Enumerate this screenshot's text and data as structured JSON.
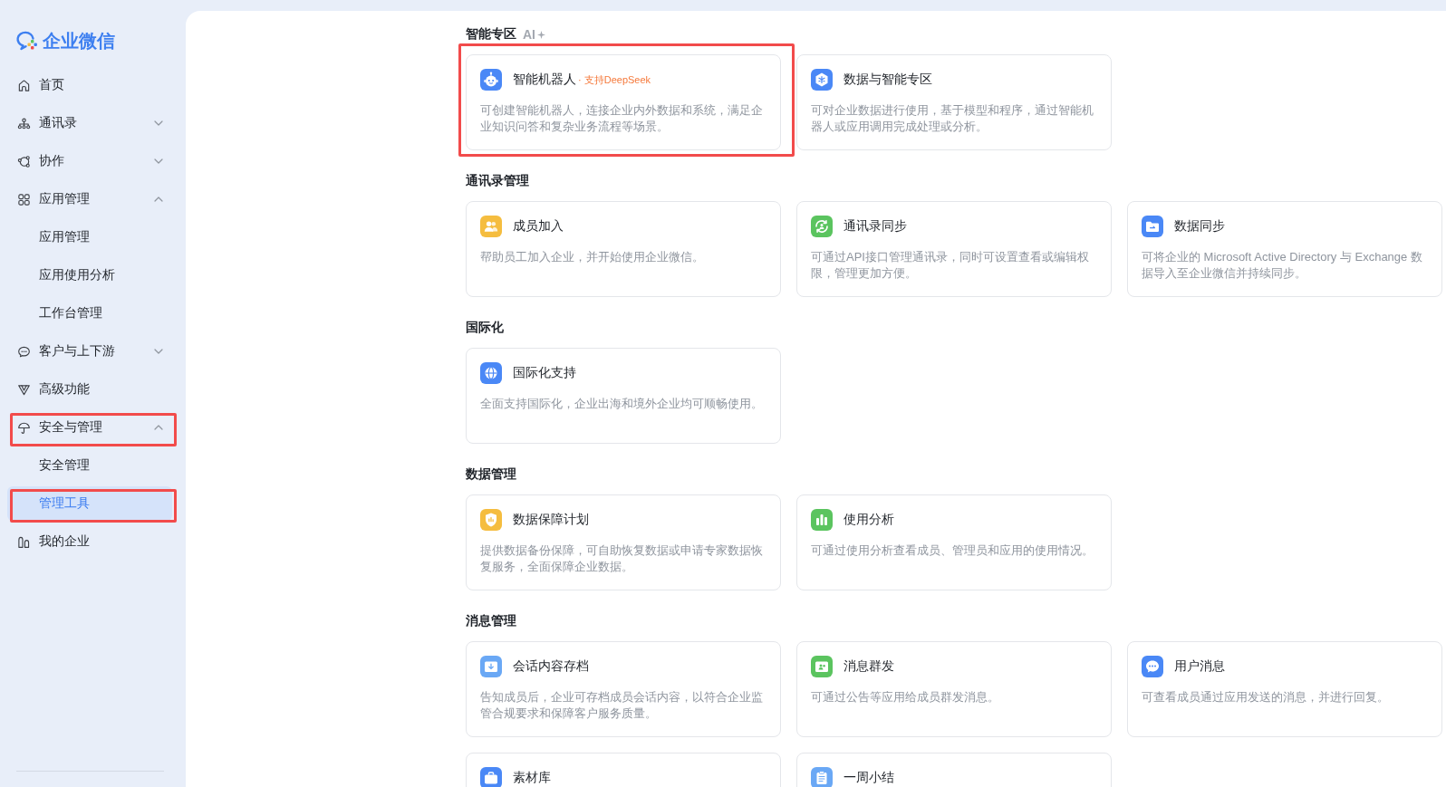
{
  "logo": {
    "text": "企业微信"
  },
  "sidebar": {
    "items": [
      {
        "kind": "page",
        "label": "首页",
        "selected": false,
        "highlighted": false
      },
      {
        "kind": "group",
        "label": "通讯录",
        "expanded": false,
        "selected": false,
        "highlighted": false
      },
      {
        "kind": "group",
        "label": "协作",
        "expanded": false,
        "selected": false,
        "highlighted": false
      },
      {
        "kind": "group",
        "label": "应用管理",
        "expanded": true,
        "selected": false,
        "highlighted": false,
        "children": [
          {
            "label": "应用管理",
            "selected": false,
            "highlighted": false
          },
          {
            "label": "应用使用分析",
            "selected": false,
            "highlighted": false
          },
          {
            "label": "工作台管理",
            "selected": false,
            "highlighted": false
          }
        ]
      },
      {
        "kind": "group",
        "label": "客户与上下游",
        "expanded": false,
        "selected": false,
        "highlighted": false
      },
      {
        "kind": "page",
        "label": "高级功能",
        "selected": false,
        "highlighted": false
      },
      {
        "kind": "group",
        "label": "安全与管理",
        "expanded": true,
        "selected": false,
        "highlighted": true,
        "children": [
          {
            "label": "安全管理",
            "selected": false,
            "highlighted": false
          },
          {
            "label": "管理工具",
            "selected": true,
            "highlighted": true
          }
        ]
      },
      {
        "kind": "page",
        "label": "我的企业",
        "selected": false,
        "highlighted": false
      }
    ]
  },
  "sections": [
    {
      "title": "智能专区",
      "tag": "AI",
      "cards": [
        {
          "title": "智能机器人",
          "note": "· 支持DeepSeek",
          "description": "可创建智能机器人，连接企业内外数据和系统，满足企业知识问答和复杂业务流程等场景。",
          "color": "#4a88f6",
          "highlighted": true
        },
        {
          "title": "数据与智能专区",
          "description": "可对企业数据进行使用，基于模型和程序，通过智能机器人或应用调用完成处理或分析。",
          "color": "#4a88f6",
          "highlighted": false
        }
      ]
    },
    {
      "title": "通讯录管理",
      "cards": [
        {
          "title": "成员加入",
          "description": "帮助员工加入企业，并开始使用企业微信。",
          "color": "#f5bd3f",
          "highlighted": false
        },
        {
          "title": "通讯录同步",
          "description": "可通过API接口管理通讯录，同时可设置查看或编辑权限，管理更加方便。",
          "color": "#5bc45f",
          "highlighted": false
        },
        {
          "title": "数据同步",
          "description": "可将企业的 Microsoft Active Directory 与 Exchange 数据导入至企业微信并持续同步。",
          "color": "#4a88f6",
          "highlighted": false
        }
      ]
    },
    {
      "title": "国际化",
      "cards": [
        {
          "title": "国际化支持",
          "description": "全面支持国际化，企业出海和境外企业均可顺畅使用。",
          "color": "#4a88f6",
          "highlighted": false
        }
      ]
    },
    {
      "title": "数据管理",
      "cards": [
        {
          "title": "数据保障计划",
          "description": "提供数据备份保障，可自助恢复数据或申请专家数据恢复服务，全面保障企业数据。",
          "color": "#f5bd3f",
          "highlighted": false
        },
        {
          "title": "使用分析",
          "description": "可通过使用分析查看成员、管理员和应用的使用情况。",
          "color": "#5bc45f",
          "highlighted": false
        }
      ]
    },
    {
      "title": "消息管理",
      "cards": [
        {
          "title": "会话内容存档",
          "description": "告知成员后，企业可存档成员会话内容，以符合企业监管合规要求和保障客户服务质量。",
          "color": "#6aa8f5",
          "highlighted": false
        },
        {
          "title": "消息群发",
          "description": "可通过公告等应用给成员群发消息。",
          "color": "#5bc45f",
          "highlighted": false
        },
        {
          "title": "用户消息",
          "description": "可查看成员通过应用发送的消息，并进行回复。",
          "color": "#4a88f6",
          "highlighted": false
        },
        {
          "title": "素材库",
          "color": "#4a88f6",
          "highlighted": false
        },
        {
          "title": "一周小结",
          "color": "#6aa8f5",
          "highlighted": false
        }
      ]
    }
  ]
}
